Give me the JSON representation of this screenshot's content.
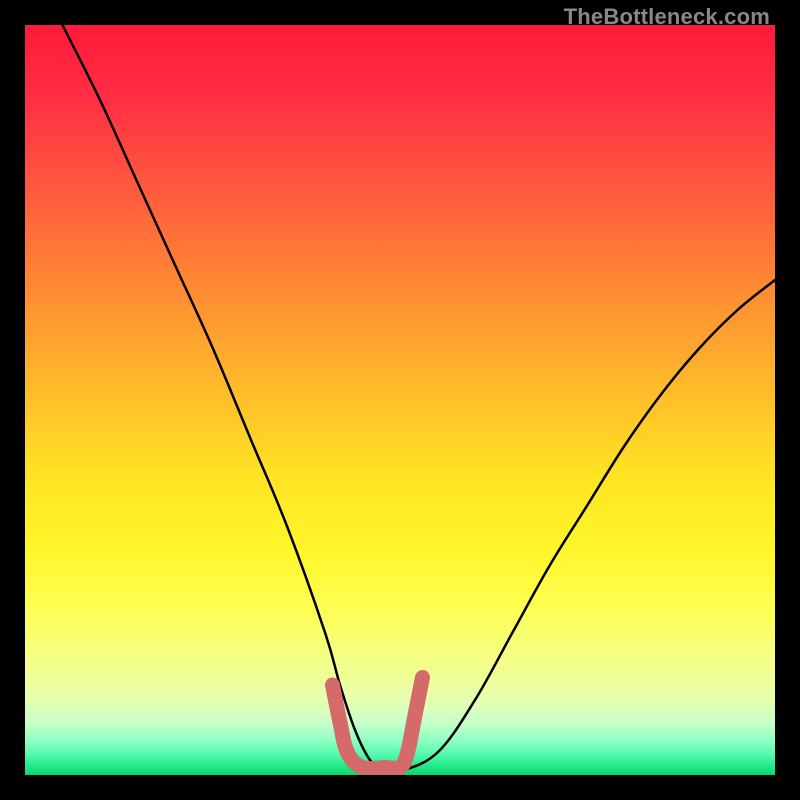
{
  "watermark": "TheBottleneck.com",
  "chart_data": {
    "type": "line",
    "title": "",
    "xlabel": "",
    "ylabel": "",
    "xlim": [
      0,
      100
    ],
    "ylim": [
      0,
      100
    ],
    "grid": false,
    "series": [
      {
        "name": "bottleneck-curve",
        "color": "#000000",
        "x": [
          5,
          10,
          15,
          20,
          25,
          30,
          35,
          40,
          42,
          44,
          46,
          48,
          50,
          55,
          60,
          65,
          70,
          75,
          80,
          85,
          90,
          95,
          100
        ],
        "values": [
          100,
          90,
          79,
          68,
          57,
          45,
          33,
          19,
          12,
          6,
          2,
          0.5,
          0.5,
          3,
          10,
          19,
          28,
          36,
          44,
          51,
          57,
          62,
          66
        ]
      },
      {
        "name": "optimal-zone-marker",
        "color": "#d46a6a",
        "x": [
          41,
          42,
          43,
          45,
          48,
          50,
          51,
          52,
          53
        ],
        "values": [
          12,
          7,
          3,
          1,
          1,
          1,
          3,
          8,
          13
        ]
      }
    ],
    "background_gradient": {
      "stops": [
        {
          "pos": 0.0,
          "color": "#ff1a3a"
        },
        {
          "pos": 0.1,
          "color": "#ff2f44"
        },
        {
          "pos": 0.22,
          "color": "#ff5a3e"
        },
        {
          "pos": 0.35,
          "color": "#ff8a34"
        },
        {
          "pos": 0.48,
          "color": "#ffb92a"
        },
        {
          "pos": 0.6,
          "color": "#ffe324"
        },
        {
          "pos": 0.7,
          "color": "#fff62a"
        },
        {
          "pos": 0.78,
          "color": "#fdff54"
        },
        {
          "pos": 0.85,
          "color": "#f4ff8a"
        },
        {
          "pos": 0.9,
          "color": "#e6ffb0"
        },
        {
          "pos": 0.93,
          "color": "#c8ffca"
        },
        {
          "pos": 0.955,
          "color": "#8cffc3"
        },
        {
          "pos": 0.975,
          "color": "#4cf7a9"
        },
        {
          "pos": 0.99,
          "color": "#1de784"
        },
        {
          "pos": 1.0,
          "color": "#08d66a"
        }
      ]
    }
  }
}
